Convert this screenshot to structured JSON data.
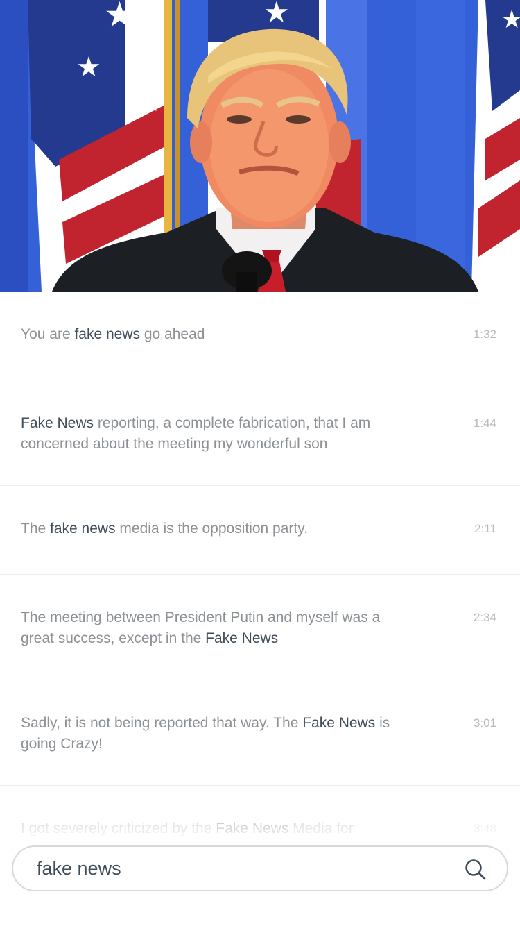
{
  "search": {
    "value": "fake news",
    "placeholder": "fake news",
    "icon": "search-icon"
  },
  "results": [
    {
      "segments": [
        {
          "text": "You are ",
          "highlight": false
        },
        {
          "text": "fake news",
          "highlight": true
        },
        {
          "text": " go ahead",
          "highlight": false
        }
      ],
      "time": "1:32"
    },
    {
      "segments": [
        {
          "text": "Fake News",
          "highlight": true
        },
        {
          "text": " reporting, a complete fabrication, that I am concerned about the meeting my wonderful son",
          "highlight": false
        }
      ],
      "time": "1:44"
    },
    {
      "segments": [
        {
          "text": "The ",
          "highlight": false
        },
        {
          "text": "fake news",
          "highlight": true
        },
        {
          "text": " media is the opposition party.",
          "highlight": false
        }
      ],
      "time": "2:11"
    },
    {
      "segments": [
        {
          "text": "The meeting between President Putin and myself was a great success, except in the ",
          "highlight": false
        },
        {
          "text": "Fake News",
          "highlight": true
        }
      ],
      "time": "2:34"
    },
    {
      "segments": [
        {
          "text": "Sadly, it is not being reported that way. The ",
          "highlight": false
        },
        {
          "text": "Fake News",
          "highlight": true
        },
        {
          "text": " is going Crazy!",
          "highlight": false
        }
      ],
      "time": "3:01"
    },
    {
      "segments": [
        {
          "text": "I got severely criticized by the ",
          "highlight": false
        },
        {
          "text": "Fake News",
          "highlight": true
        },
        {
          "text": " Media for",
          "highlight": false
        }
      ],
      "time": "3:48"
    }
  ],
  "colors": {
    "highlight": "#3f4d5a",
    "text": "#8c9196",
    "time": "#b7babd",
    "divider": "#ececec",
    "search_border": "#d7d9db"
  }
}
